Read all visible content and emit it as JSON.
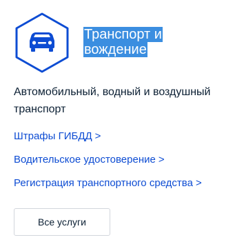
{
  "category": {
    "icon": "car-icon",
    "accent_color": "#0d4cd3",
    "title_lines": [
      "Транспорт и",
      "вождение"
    ],
    "description_lines": [
      "Автомобильный, водный и воздушный",
      "транспорт"
    ]
  },
  "links": [
    {
      "label": "Штрафы ГИБДД",
      "chevron": ">"
    },
    {
      "label": "Водительское удостоверение",
      "chevron": ">"
    },
    {
      "label": "Регистрация транспортного средства",
      "chevron": ">"
    }
  ],
  "all_services_button": {
    "label": "Все услуги"
  }
}
